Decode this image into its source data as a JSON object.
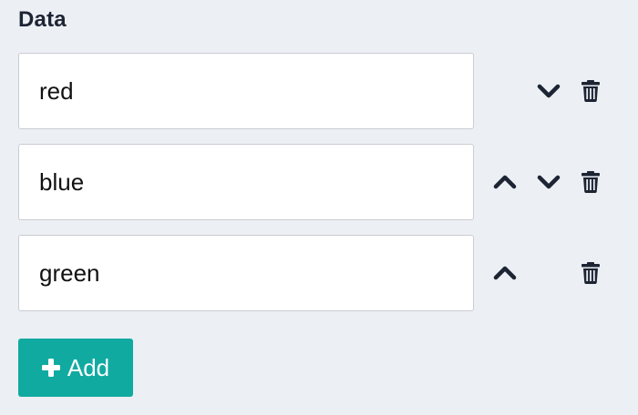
{
  "section": {
    "title": "Data"
  },
  "items": [
    {
      "value": "red",
      "actions": [
        "chevron-down-icon",
        "trash-icon"
      ]
    },
    {
      "value": "blue",
      "actions": [
        "chevron-up-icon",
        "chevron-down-icon",
        "trash-icon"
      ]
    },
    {
      "value": "green",
      "actions": [
        "chevron-up-icon",
        "trash-icon"
      ]
    }
  ],
  "add_button": {
    "label": "Add",
    "icon": "plus-icon"
  },
  "colors": {
    "background": "#eceff4",
    "accent": "#11aaa1",
    "icon": "#1d2433",
    "field_border": "#c9ccd2"
  }
}
